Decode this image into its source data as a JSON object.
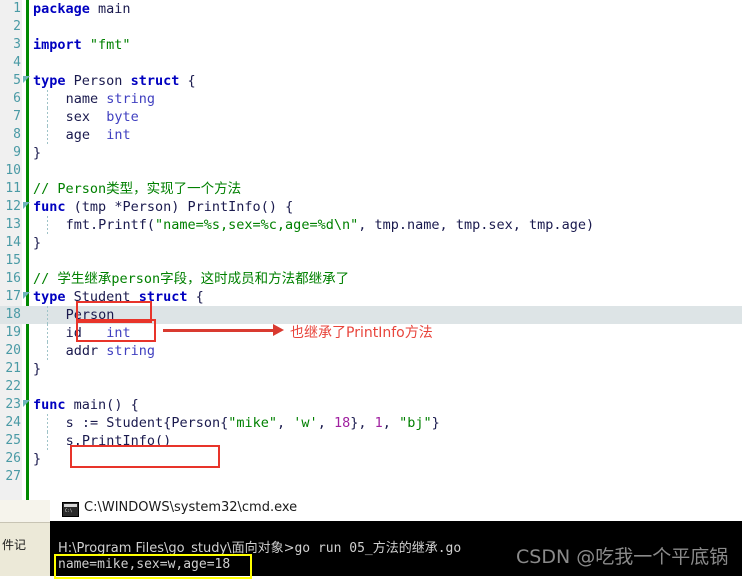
{
  "editor": {
    "language": "go",
    "gutter_color": "#4a9aa5",
    "highlight_line": 18,
    "lines": [
      {
        "n": "1",
        "text": "package main"
      },
      {
        "n": "2",
        "text": ""
      },
      {
        "n": "3",
        "text": "import \"fmt\""
      },
      {
        "n": "4",
        "text": ""
      },
      {
        "n": "5",
        "text": "type Person struct {"
      },
      {
        "n": "6",
        "text": "    name string"
      },
      {
        "n": "7",
        "text": "    sex  byte"
      },
      {
        "n": "8",
        "text": "    age  int"
      },
      {
        "n": "9",
        "text": "}"
      },
      {
        "n": "10",
        "text": ""
      },
      {
        "n": "11",
        "text": "// Person类型，实现了一个方法"
      },
      {
        "n": "12",
        "text": "func (tmp *Person) PrintInfo() {"
      },
      {
        "n": "13",
        "text": "    fmt.Printf(\"name=%s,sex=%c,age=%d\\n\", tmp.name, tmp.sex, tmp.age)"
      },
      {
        "n": "14",
        "text": "}"
      },
      {
        "n": "15",
        "text": ""
      },
      {
        "n": "16",
        "text": "// 学生继承person字段，这时成员和方法都继承了"
      },
      {
        "n": "17",
        "text": "type Student struct {"
      },
      {
        "n": "18",
        "text": "    Person"
      },
      {
        "n": "19",
        "text": "    id   int"
      },
      {
        "n": "20",
        "text": "    addr string"
      },
      {
        "n": "21",
        "text": "}"
      },
      {
        "n": "22",
        "text": ""
      },
      {
        "n": "23",
        "text": "func main() {"
      },
      {
        "n": "24",
        "text": "    s := Student{Person{\"mike\", 'w', 18}, 1, \"bj\"}"
      },
      {
        "n": "25",
        "text": "    s.PrintInfo()"
      },
      {
        "n": "26",
        "text": "}"
      },
      {
        "n": "27",
        "text": ""
      }
    ]
  },
  "annotations": {
    "boxed_student": "Student",
    "boxed_person": "Person",
    "boxed_call": "s.PrintInfo()",
    "arrow_label": "也继承了PrintInfo方法",
    "annotation_color": "#e8453c"
  },
  "background_window": {
    "label_fragment": "件记"
  },
  "console": {
    "title": "C:\\WINDOWS\\system32\\cmd.exe",
    "icon": "cmd-icon",
    "prompt_path": "H:\\Program Files\\go_study\\面向对象>",
    "command": "go run 05_方法的继承.go",
    "output": "name=mike,sex=w,age=18",
    "output_highlight_color": "#ffff00",
    "background": "#000000",
    "text_color": "#d0d0d0"
  },
  "watermark": {
    "text": "CSDN @吃我一个平底锅"
  }
}
